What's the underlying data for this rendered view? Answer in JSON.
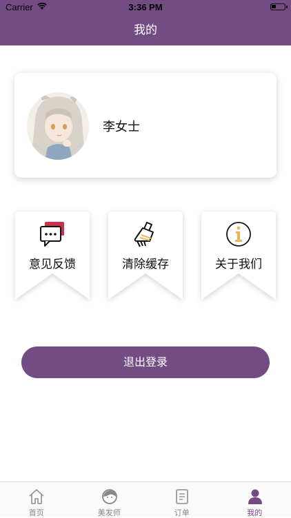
{
  "status_bar": {
    "carrier": "Carrier",
    "time": "3:36 PM"
  },
  "nav": {
    "title": "我的"
  },
  "profile": {
    "name": "李女士"
  },
  "actions": [
    {
      "label": "意见反馈",
      "icon": "chat-bubbles-icon"
    },
    {
      "label": "清除缓存",
      "icon": "broom-icon"
    },
    {
      "label": "关于我们",
      "icon": "info-icon"
    }
  ],
  "logout": {
    "label": "退出登录"
  },
  "tabs": [
    {
      "label": "首页",
      "icon": "home-icon",
      "active": false
    },
    {
      "label": "美发师",
      "icon": "hairdresser-icon",
      "active": false
    },
    {
      "label": "订单",
      "icon": "order-icon",
      "active": false
    },
    {
      "label": "我的",
      "icon": "person-icon",
      "active": true
    }
  ],
  "colors": {
    "brand": "#744c84",
    "tab_inactive": "#888888",
    "icon_accent": "#e8b75a",
    "icon_red": "#c8324a"
  }
}
